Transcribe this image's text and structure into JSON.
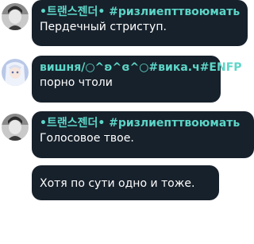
{
  "messages": [
    {
      "sender": "•트랜스젠더• #ризлиепттвоюмать",
      "text": "Пердечный стриступ.",
      "sender_color": "#5dd6c8"
    },
    {
      "sender": "вишня/○^ʚ^ɞ^○#вика.ч#ENFP",
      "text": "порно чтоли",
      "sender_color": "#5dd6c8"
    },
    {
      "sender": "•트랜스젠더• #ризлиепттвоюмать",
      "text": "Голосовое твое.",
      "sender_color": "#5dd6c8"
    },
    {
      "text": "Хотя по сути одно и тоже."
    }
  ],
  "theme": {
    "bubble_color": "#17212b",
    "page_background": "#ffffff"
  }
}
